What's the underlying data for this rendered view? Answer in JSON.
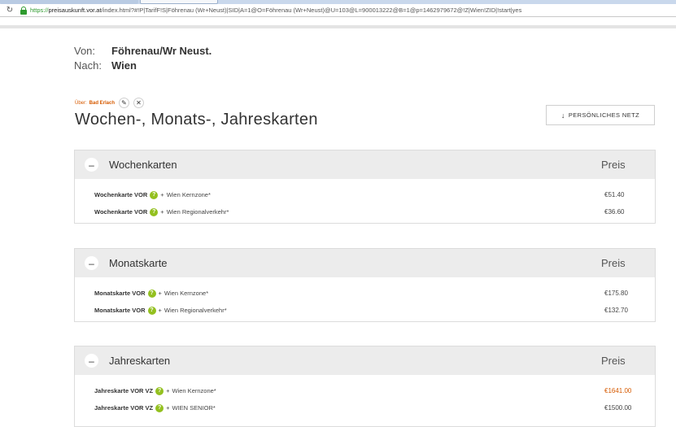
{
  "browser": {
    "url_proto": "https://",
    "url_host": "preisauskunft.vor.at",
    "url_rest": "/index.html?#!P|TarifF!S|Föhrenau (Wr+Neust)|SID|A=1@O=Föhrenau (Wr+Neust)@U=103@L=900013222@B=1@p=1462979672@!Z|Wien!ZID|!start|yes"
  },
  "route": {
    "from_label": "Von:",
    "from_value": "Föhrenau/Wr Neust.",
    "to_label": "Nach:",
    "to_value": "Wien"
  },
  "via": {
    "prefix": "Über:",
    "place": "Bad Erlach"
  },
  "page_title": "Wochen-, Monats-, Jahreskarten",
  "network_button": "PERSÖNLICHES NETZ",
  "sections": [
    {
      "title": "Wochenkarten",
      "price_header": "Preis",
      "toggle": "–",
      "fares": [
        {
          "name": "Wochenkarte VOR",
          "plus": "+",
          "zone": "Wien Kernzone*",
          "price": "€51.40"
        },
        {
          "name": "Wochenkarte VOR",
          "plus": "+",
          "zone": "Wien Regionalverkehr*",
          "price": "€36.60"
        }
      ]
    },
    {
      "title": "Monatskarte",
      "price_header": "Preis",
      "toggle": "–",
      "fares": [
        {
          "name": "Monatskarte VOR",
          "plus": "+",
          "zone": "Wien Kernzone*",
          "price": "€175.80"
        },
        {
          "name": "Monatskarte VOR",
          "plus": "+",
          "zone": "Wien Regionalverkehr*",
          "price": "€132.70"
        }
      ]
    },
    {
      "title": "Jahreskarten",
      "price_header": "Preis",
      "toggle": "–",
      "fares": [
        {
          "name": "Jahreskarte VOR VZ",
          "plus": "+",
          "zone": "Wien Kernzone*",
          "price": "€1641.00"
        },
        {
          "name": "Jahreskarte VOR VZ",
          "plus": "+",
          "zone": "WIEN SENIOR*",
          "price": "€1500.00"
        }
      ]
    }
  ],
  "info_glyph": "?",
  "colors": {
    "accent_orange": "#d65a00",
    "info_green": "#93c01f",
    "section_header_bg": "#ececec"
  }
}
